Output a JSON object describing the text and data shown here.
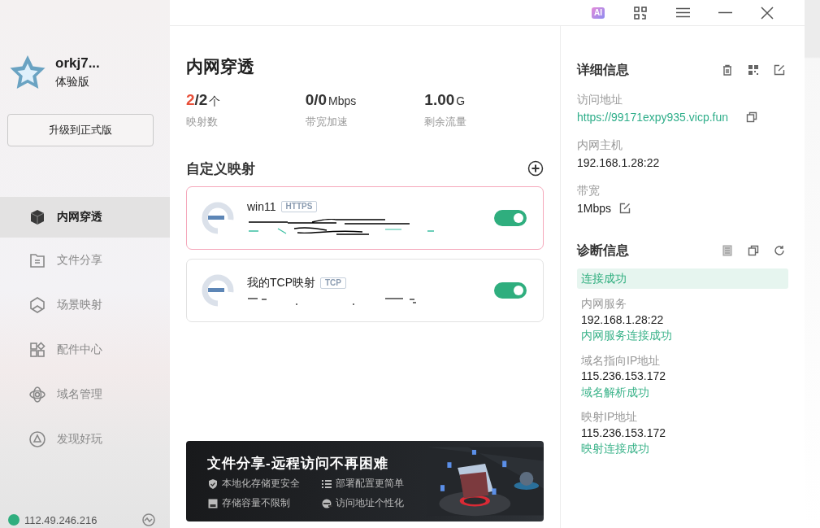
{
  "toolbar": {
    "ai_badge": "AI"
  },
  "account": {
    "name": "orkj7...",
    "plan": "体验版",
    "upgrade_button": "升级到正式版"
  },
  "nav": [
    {
      "label": "内网穿透",
      "selected": true
    },
    {
      "label": "文件分享",
      "selected": false
    },
    {
      "label": "场景映射",
      "selected": false
    },
    {
      "label": "配件中心",
      "selected": false
    },
    {
      "label": "域名管理",
      "selected": false
    },
    {
      "label": "发现好玩",
      "selected": false
    }
  ],
  "ip_status": {
    "address": "112.49.246.216"
  },
  "page": {
    "title": "内网穿透",
    "stats": [
      {
        "accent": "2",
        "value": "/2",
        "unit": "个",
        "label": "映射数"
      },
      {
        "value": "0/0",
        "unit": "Mbps",
        "label": "带宽加速"
      },
      {
        "value": "1.00",
        "unit": "G",
        "label": "剩余流量"
      }
    ]
  },
  "mappings": {
    "title": "自定义映射",
    "items": [
      {
        "name": "win11",
        "protocol": "HTTPS",
        "enabled": true,
        "selected": true
      },
      {
        "name": "我的TCP映射",
        "protocol": "TCP",
        "enabled": true,
        "selected": false
      }
    ]
  },
  "banner": {
    "title": "文件分享-远程访问不再困难",
    "features": [
      "本地化存储更安全",
      "部署配置更简单",
      "存储容量不限制",
      "访问地址个性化"
    ]
  },
  "details": {
    "title": "详细信息",
    "fields": [
      {
        "label": "访问地址",
        "value": "https://99171expy935.vicp.fun",
        "kind": "link"
      },
      {
        "label": "内网主机",
        "value": "192.168.1.28:22",
        "kind": "plain"
      },
      {
        "label": "带宽",
        "value": "1Mbps",
        "kind": "editable"
      }
    ]
  },
  "diagnostics": {
    "title": "诊断信息",
    "status": "连接成功",
    "checks": [
      {
        "label": "内网服务",
        "value": "192.168.1.28:22",
        "result": "内网服务连接成功"
      },
      {
        "label": "域名指向IP地址",
        "value": "115.236.153.172",
        "result": "域名解析成功"
      },
      {
        "label": "映射IP地址",
        "value": "115.236.153.172",
        "result": "映射连接成功"
      }
    ]
  }
}
